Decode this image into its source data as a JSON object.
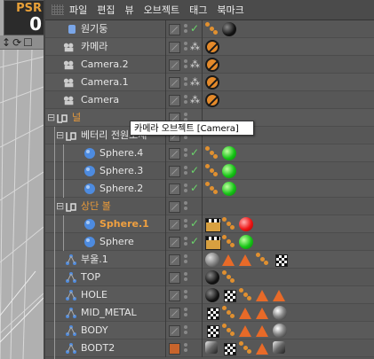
{
  "psr": {
    "label": "PSR",
    "value": "0"
  },
  "viewport_tools": [
    "↕",
    "⟳",
    "☐"
  ],
  "menu": [
    "파일",
    "편집",
    "뷰",
    "오브젝트",
    "태그",
    "북마크"
  ],
  "tooltip": "카메라 오브젝트 [Camera]",
  "objects": [
    {
      "name": "원기둥"
    },
    {
      "name": "카메라"
    },
    {
      "name": "Camera.2"
    },
    {
      "name": "Camera.1"
    },
    {
      "name": "Camera"
    },
    {
      "name": "널"
    },
    {
      "name": "베터리 전원소재"
    },
    {
      "name": "Sphere.4"
    },
    {
      "name": "Sphere.3"
    },
    {
      "name": "Sphere.2"
    },
    {
      "name": "상단 볼"
    },
    {
      "name": "Sphere.1"
    },
    {
      "name": "Sphere"
    },
    {
      "name": "부울.1"
    },
    {
      "name": "TOP"
    },
    {
      "name": "HOLE"
    },
    {
      "name": "MID_METAL"
    },
    {
      "name": "BODY"
    },
    {
      "name": "BODT2"
    }
  ]
}
